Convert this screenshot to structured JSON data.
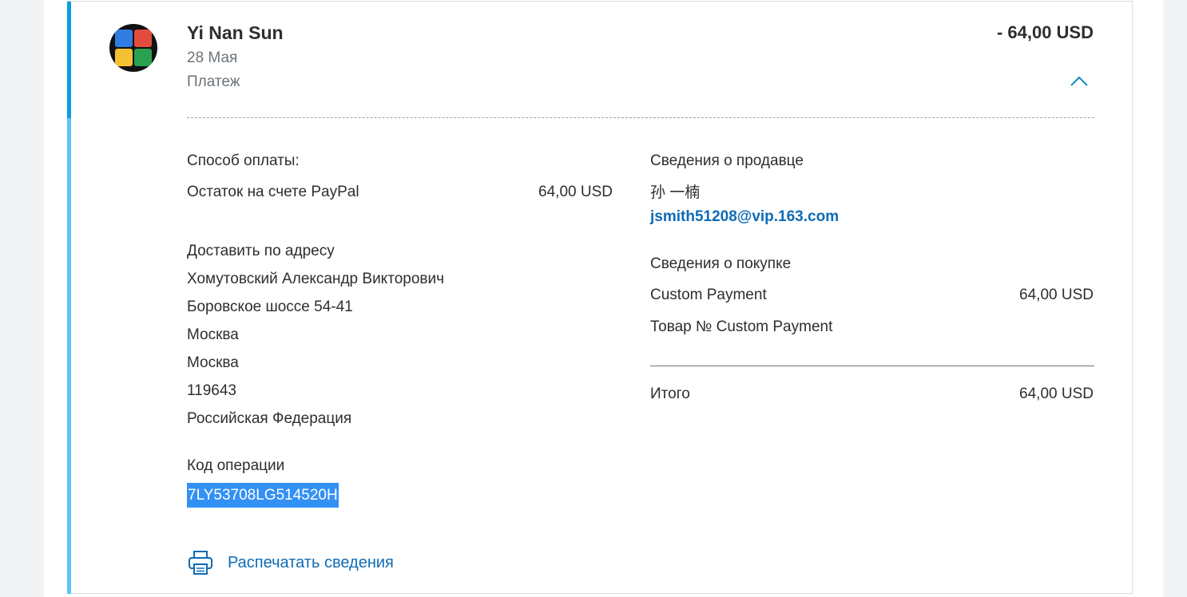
{
  "transaction": {
    "name": "Yi Nan Sun",
    "date": "28 Мая",
    "type": "Платеж",
    "amount": "- 64,00 USD"
  },
  "payment": {
    "method_label": "Способ оплаты:",
    "source_label": "Остаток на счете PayPal",
    "source_amount": "64,00 USD"
  },
  "shipping": {
    "label": "Доставить по адресу",
    "name": "Хомутовский Александр Викторович",
    "street": "Боровское шоссе 54-41",
    "city": "Москва",
    "region": "Москва",
    "zip": "119643",
    "country": "Российская Федерация"
  },
  "operation": {
    "label": "Код операции",
    "id": "7LY53708LG514520H"
  },
  "seller": {
    "label": "Сведения о продавце",
    "name": "孙 一楠",
    "email": "jsmith51208@vip.163.com"
  },
  "purchase": {
    "label": "Сведения о покупке",
    "item_name": "Custom Payment",
    "item_amount": "64,00 USD",
    "item_number": "Товар № Custom Payment",
    "total_label": "Итого",
    "total_amount": "64,00 USD"
  },
  "actions": {
    "print_label": "Распечатать сведения"
  },
  "icons": {
    "chevron": "chevron-up-icon",
    "print": "printer-icon"
  },
  "colors": {
    "accent_top": "#0a9ee3",
    "accent_bottom": "#5bc6f5",
    "link": "#0e6bb5",
    "selection": "#3390f5"
  }
}
